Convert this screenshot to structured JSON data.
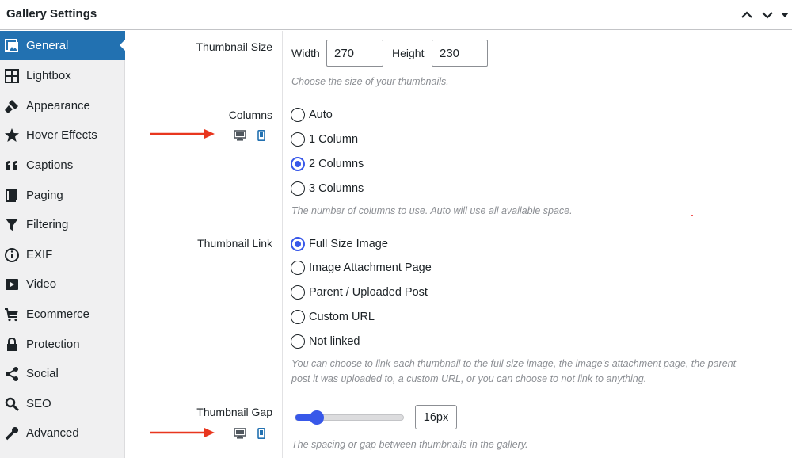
{
  "header": {
    "title": "Gallery Settings",
    "collapse_icon": "chevron-up-icon",
    "expand_icon": "chevron-down-icon"
  },
  "sidebar": {
    "items": [
      {
        "label": "General",
        "icon": "gallery-icon",
        "active": true
      },
      {
        "label": "Lightbox",
        "icon": "grid-icon"
      },
      {
        "label": "Appearance",
        "icon": "brush-icon"
      },
      {
        "label": "Hover Effects",
        "icon": "star-icon"
      },
      {
        "label": "Captions",
        "icon": "quote-icon"
      },
      {
        "label": "Paging",
        "icon": "pages-icon"
      },
      {
        "label": "Filtering",
        "icon": "filter-icon"
      },
      {
        "label": "EXIF",
        "icon": "info-icon"
      },
      {
        "label": "Video",
        "icon": "video-icon"
      },
      {
        "label": "Ecommerce",
        "icon": "cart-icon"
      },
      {
        "label": "Protection",
        "icon": "lock-icon"
      },
      {
        "label": "Social",
        "icon": "share-icon"
      },
      {
        "label": "SEO",
        "icon": "search-icon"
      },
      {
        "label": "Advanced",
        "icon": "wrench-icon"
      }
    ]
  },
  "thumbnail_size": {
    "label": "Thumbnail Size",
    "width_label": "Width",
    "width_value": "270",
    "height_label": "Height",
    "height_value": "230",
    "description": "Choose the size of your thumbnails."
  },
  "columns": {
    "label": "Columns",
    "options": [
      "Auto",
      "1 Column",
      "2 Columns",
      "3 Columns"
    ],
    "selected": "2 Columns",
    "description": "The number of columns to use. Auto will use all available space."
  },
  "thumbnail_link": {
    "label": "Thumbnail Link",
    "options": [
      "Full Size Image",
      "Image Attachment Page",
      "Parent / Uploaded Post",
      "Custom URL",
      "Not linked"
    ],
    "selected": "Full Size Image",
    "description_line1": "You can choose to link each thumbnail to the full size image, the image's attachment page, the parent",
    "description_line2": "post it was uploaded to, a custom URL, or you can choose to not link to anything."
  },
  "thumbnail_gap": {
    "label": "Thumbnail Gap",
    "value": "16px",
    "slider_fraction": 0.2,
    "description": "The spacing or gap between thumbnails in the gallery."
  },
  "colors": {
    "accent": "#2271b1",
    "radio": "#3858e9",
    "arrow": "#e8361e"
  }
}
